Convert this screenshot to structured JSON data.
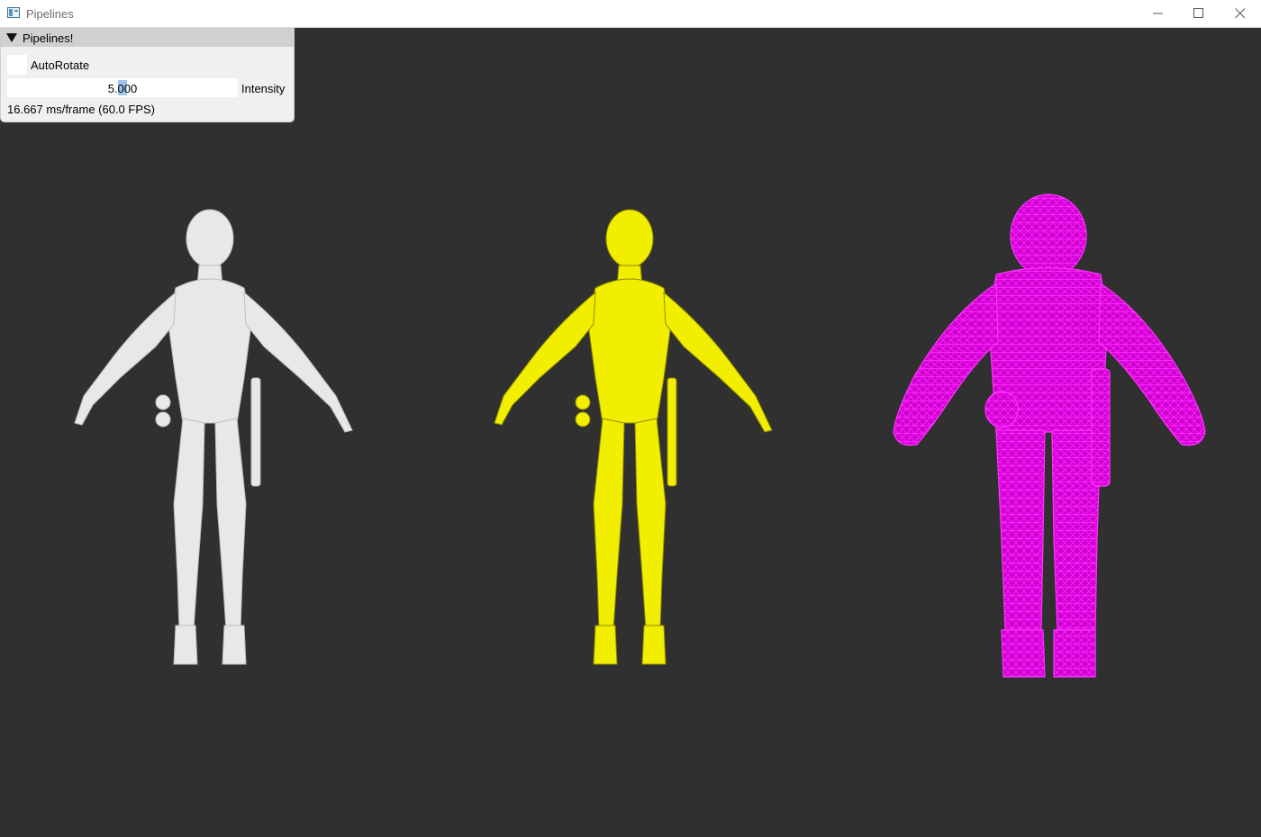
{
  "window": {
    "title": "Pipelines"
  },
  "panel": {
    "title": "Pipelines!",
    "checkbox_label": "AutoRotate",
    "checkbox_checked": false,
    "slider_value": "5.000",
    "slider_label": "Intensity",
    "stats": "16.667 ms/frame (60.0 FPS)"
  },
  "figures": [
    {
      "style": "phong",
      "color": "#ffffff"
    },
    {
      "style": "toon",
      "color": "#ffff00"
    },
    {
      "style": "wireframe",
      "color": "#ff00ff"
    }
  ]
}
